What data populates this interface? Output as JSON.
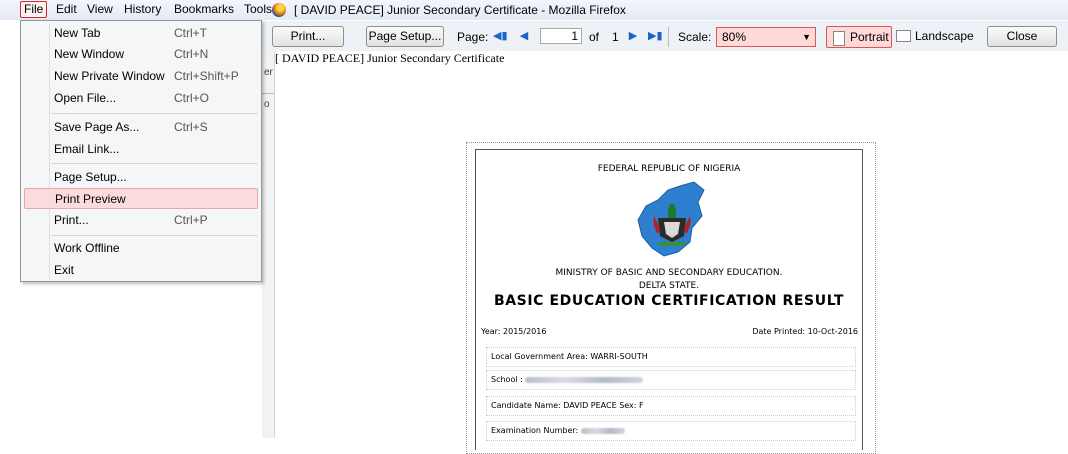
{
  "menubar": {
    "file": "File",
    "edit": "Edit",
    "view": "View",
    "history": "History",
    "bookmarks": "Bookmarks",
    "tools": "Tools"
  },
  "window": {
    "title": "[ DAVID PEACE]  Junior Secondary Certificate - Mozilla Firefox"
  },
  "toolbar": {
    "print": "Print...",
    "page_setup": "Page Setup...",
    "page_label": "Page:",
    "page_current": "1",
    "page_of": "of",
    "page_total": "1",
    "scale_label": "Scale:",
    "scale_value": "80%",
    "portrait": "Portrait",
    "landscape": "Landscape",
    "close": "Close"
  },
  "left_strip": {
    "text_er": "er",
    "text_o": "o"
  },
  "file_menu": {
    "items": [
      {
        "label": "New Tab",
        "shortcut": "Ctrl+T"
      },
      {
        "label": "New Window",
        "shortcut": "Ctrl+N"
      },
      {
        "label": "New Private Window",
        "shortcut": "Ctrl+Shift+P"
      },
      {
        "label": "Open File...",
        "shortcut": "Ctrl+O"
      },
      {
        "label": "Save Page As...",
        "shortcut": "Ctrl+S"
      },
      {
        "label": "Email Link...",
        "shortcut": ""
      },
      {
        "label": "Page Setup...",
        "shortcut": ""
      },
      {
        "label": "Print Preview",
        "shortcut": ""
      },
      {
        "label": "Print...",
        "shortcut": "Ctrl+P"
      },
      {
        "label": "Work Offline",
        "shortcut": ""
      },
      {
        "label": "Exit",
        "shortcut": ""
      }
    ],
    "highlighted": "Print Preview"
  },
  "preview": {
    "header": "[ DAVID PEACE]  Junior Secondary Certificate",
    "certificate": {
      "federal": "FEDERAL REPUBLIC OF NIGERIA",
      "ministry": "MINISTRY OF BASIC AND SECONDARY EDUCATION.",
      "state": "DELTA STATE.",
      "result_title": "BASIC EDUCATION CERTIFICATION RESULT",
      "year": "Year: 2015/2016",
      "date_printed": "Date Printed: 10-Oct-2016",
      "lga": "Local Government Area: WARRI-SOUTH",
      "school_label": "School :",
      "candidate": "Candidate Name: DAVID PEACE Sex: F",
      "exam_number_label": "Examination Number:"
    }
  },
  "colors": {
    "accent_red": "#d02a2a",
    "highlight_bg": "#fbdcdc",
    "nav_blue": "#1b62c9",
    "map_blue": "#2f7fd0"
  }
}
